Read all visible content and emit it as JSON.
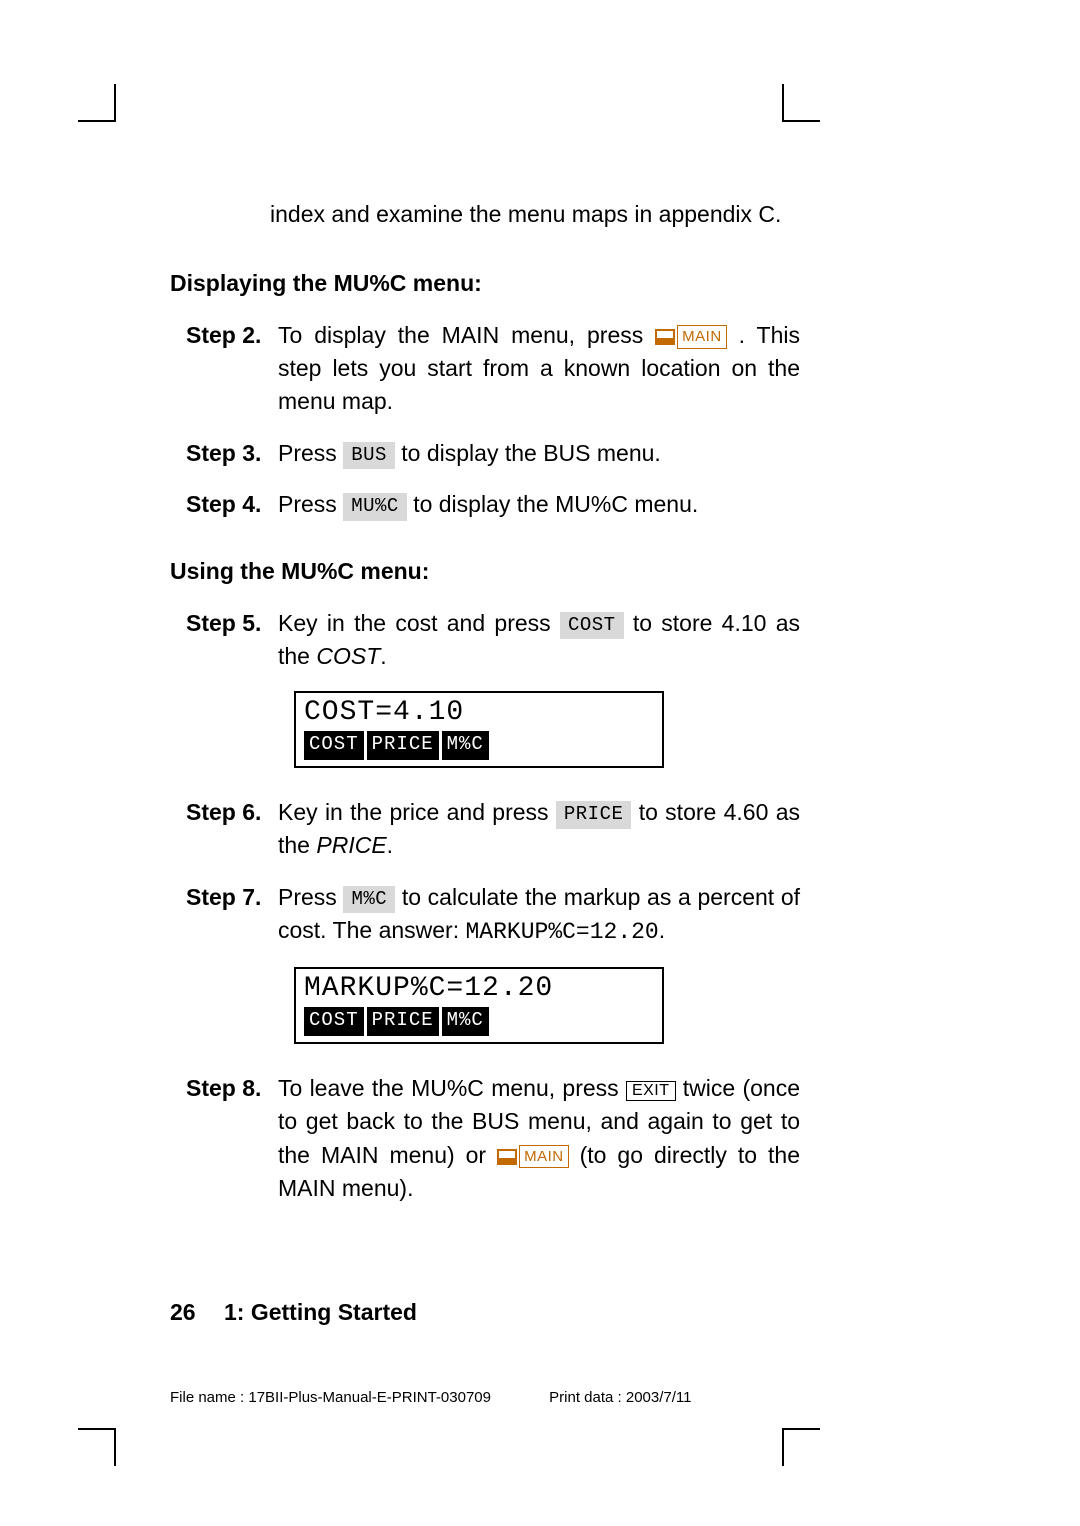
{
  "intro": "index and examine the menu maps in appendix C.",
  "heading1": "Displaying the MU%C menu:",
  "heading2": "Using the MU%C menu:",
  "keys": {
    "main": "MAIN",
    "bus": "BUS",
    "mupc": "MU%C",
    "cost": "COST",
    "price": "PRICE",
    "mpc": "M%C",
    "exit": "EXIT"
  },
  "steps": {
    "s2": {
      "label": "Step 2.",
      "pre": "To display the MAIN menu, press ",
      "post": ". This step lets you start from a known location on the menu map."
    },
    "s3": {
      "label": "Step 3.",
      "pre": "Press ",
      "post": " to display the BUS menu."
    },
    "s4": {
      "label": "Step 4.",
      "pre": "Press ",
      "post": " to display the MU%C menu."
    },
    "s5": {
      "label": "Step 5.",
      "pre": "Key in the cost and press ",
      "post": " to store 4.10 as the ",
      "ital": "COST",
      "tail": "."
    },
    "s6": {
      "label": "Step 6.",
      "pre": "Key in the price and press ",
      "post": " to store 4.60 as the ",
      "ital": "PRICE",
      "tail": "."
    },
    "s7": {
      "label": "Step 7.",
      "pre": "Press ",
      "post": " to calculate the markup as a percent of cost. The answer: ",
      "mono": "MARKUP%C=12.20",
      "tail": "."
    },
    "s8": {
      "label": "Step 8.",
      "pre": "To leave the MU%C menu, press ",
      "mid": " twice (once to get back to the BUS menu, and again to get to the MAIN menu) or ",
      "post": " (to go directly to the MAIN menu)."
    }
  },
  "screen1": {
    "line": "COST=4.10",
    "menu": [
      "COST",
      "PRICE",
      "M%C"
    ]
  },
  "screen2": {
    "line": "MARKUP%C=12.20",
    "menu": [
      "COST",
      "PRICE",
      "M%C"
    ]
  },
  "footer": {
    "page": "26",
    "chapter": "1: Getting Started",
    "file": "File name : 17BII-Plus-Manual-E-PRINT-030709",
    "print": "Print data : 2003/7/11"
  }
}
